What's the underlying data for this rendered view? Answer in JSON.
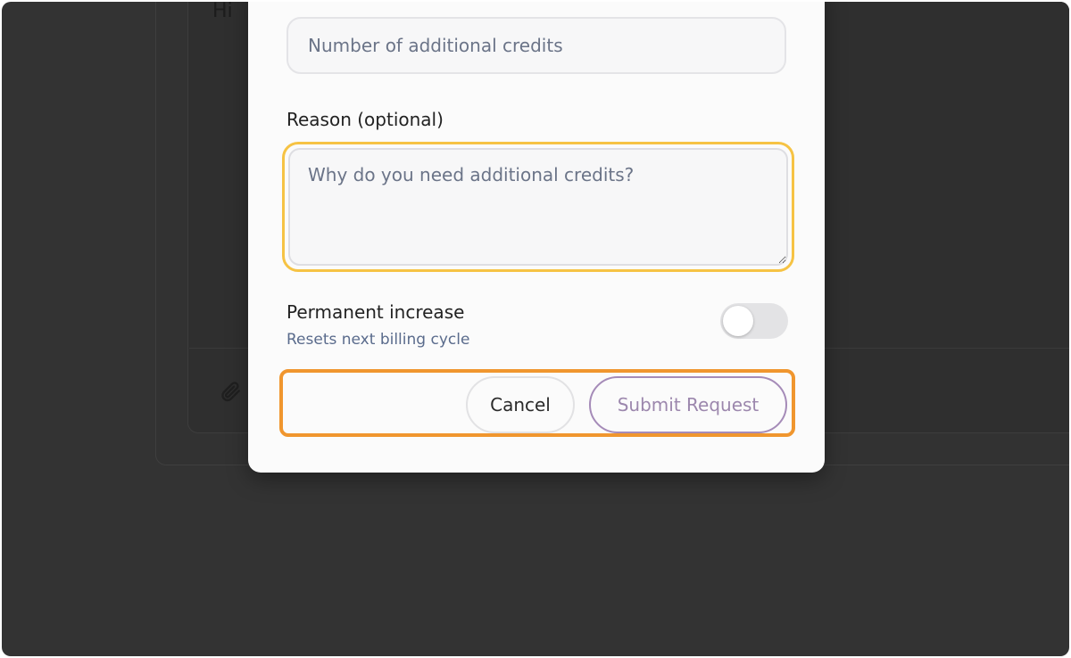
{
  "background": {
    "greeting": "Hi"
  },
  "form": {
    "credits_placeholder": "Number of additional credits",
    "reason_label": "Reason (optional)",
    "reason_placeholder": "Why do you need additional credits?",
    "permanent_title": "Permanent increase",
    "permanent_subtitle": "Resets next billing cycle",
    "permanent_enabled": false
  },
  "actions": {
    "cancel_label": "Cancel",
    "submit_label": "Submit Request"
  },
  "colors": {
    "focus_ring": "#f6c344",
    "highlight": "#f0962e",
    "submit_accent": "#a58bb8"
  },
  "icons": {
    "attach": "paperclip-icon"
  }
}
